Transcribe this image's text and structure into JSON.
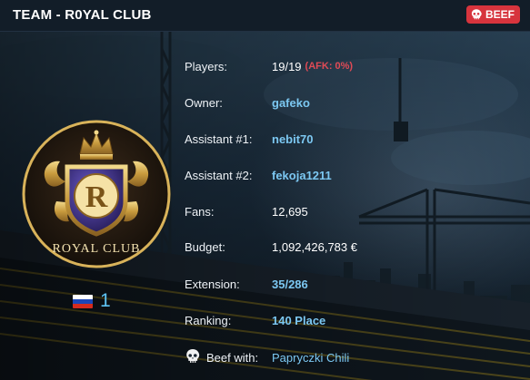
{
  "header": {
    "title": "TEAM - R0YAL CLUB",
    "beef_label": "BEEF"
  },
  "logo": {
    "club_name": "ROYAL CLUB",
    "monogram": "R"
  },
  "rank": {
    "country": "Russia",
    "value": "1"
  },
  "info": {
    "players_label": "Players:",
    "players_value": "19/19",
    "afk_text": "(AFK: 0%)",
    "owner_label": "Owner:",
    "owner_value": "gafeko",
    "assistant1_label": "Assistant #1:",
    "assistant1_value": "nebit70",
    "assistant2_label": "Assistant #2:",
    "assistant2_value": "fekoja1211",
    "fans_label": "Fans:",
    "fans_value": "12,695",
    "budget_label": "Budget:",
    "budget_value": "1,092,426,783 €",
    "extension_label": "Extension:",
    "extension_value": "35/286",
    "ranking_label": "Ranking:",
    "ranking_value": "140 Place",
    "beef_label": "Beef with:",
    "beef_value": "Papryczki Chili"
  },
  "colors": {
    "accent_link": "#7cc8f2",
    "afk_red": "#e04a55",
    "beef_badge": "#d7343d",
    "gold": "#d9b35a"
  },
  "icons": {
    "beef_badge_icon": "skull-icon",
    "beef_row_icon": "skull-icon",
    "country_flag": "russia-flag-icon"
  }
}
